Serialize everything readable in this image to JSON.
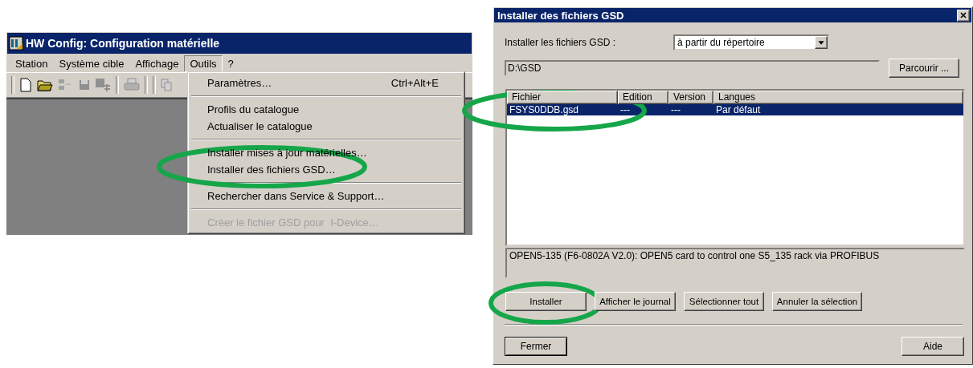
{
  "hw_window": {
    "title": "HW Config: Configuration matérielle",
    "menu_bar": [
      {
        "label": "Station",
        "selected": false
      },
      {
        "label": "Système cible",
        "selected": false
      },
      {
        "label": "Affichage",
        "selected": false
      },
      {
        "label": "Outils",
        "selected": true
      },
      {
        "label": "?",
        "selected": false
      }
    ],
    "menu": [
      {
        "kind": "item",
        "label": "Paramètres…",
        "shortcut": "Ctrl+Alt+E",
        "disabled": false
      },
      {
        "kind": "separator"
      },
      {
        "kind": "item",
        "label": "Profils du catalogue",
        "disabled": false
      },
      {
        "kind": "item",
        "label": "Actualiser le catalogue",
        "disabled": false
      },
      {
        "kind": "separator"
      },
      {
        "kind": "item",
        "label": "Installer mises à jour matérielles…",
        "disabled": false
      },
      {
        "kind": "item",
        "label": "Installer des fichiers GSD…",
        "disabled": false
      },
      {
        "kind": "separator"
      },
      {
        "kind": "item",
        "label": "Rechercher dans Service & Support…",
        "disabled": false
      },
      {
        "kind": "separator"
      },
      {
        "kind": "item",
        "label": "Créer le fichier GSD pour  I-Device…",
        "disabled": true
      }
    ]
  },
  "dialog": {
    "title": "Installer des fichiers GSD",
    "source_label": "Installer les fichiers GSD :",
    "source_value": "à partir du répertoire",
    "path_value": "D:\\GSD",
    "browse_button": "Parcourir ...",
    "table": {
      "columns": [
        "Fichier",
        "Edition",
        "Version",
        "Langues"
      ],
      "rows": [
        {
          "cells": [
            "FSYS0DDB.gsd",
            "---",
            "---",
            "Par défaut"
          ],
          "selected": true
        }
      ]
    },
    "description": "OPEN5-135 (F6-0802A V2.0): OPEN5 card to control one S5_135 rack via PROFIBUS",
    "action_buttons": [
      "Installer",
      "Afficher le journal",
      "Sélectionner tout",
      "Annuler la sélection"
    ],
    "close_button": "Fermer",
    "help_button": "Aide"
  }
}
